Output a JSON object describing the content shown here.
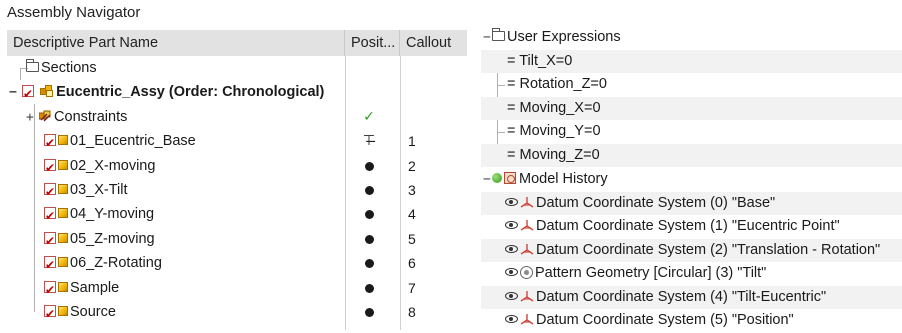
{
  "assembly_navigator": {
    "title": "Assembly Navigator",
    "columns": {
      "name": "Descriptive Part Name",
      "position": "Posit...",
      "callout": "Callout"
    },
    "rows": [
      {
        "label": "Sections",
        "icon": "folder-icon",
        "position": "",
        "callout": ""
      },
      {
        "label": "Eucentric_Assy (Order: Chronological)",
        "icon": "assembly-icon",
        "position": "",
        "callout": ""
      },
      {
        "label": "Constraints",
        "icon": "constraints-icon",
        "position": "✓",
        "callout": ""
      },
      {
        "label": "01_Eucentric_Base",
        "icon": "part-icon",
        "position": "⊤̶",
        "callout": "1"
      },
      {
        "label": "02_X-moving",
        "icon": "part-icon",
        "position": "●",
        "callout": "2"
      },
      {
        "label": "03_X-Tilt",
        "icon": "part-icon",
        "position": "●",
        "callout": "3"
      },
      {
        "label": "04_Y-moving",
        "icon": "part-icon",
        "position": "●",
        "callout": "4"
      },
      {
        "label": "05_Z-moving",
        "icon": "part-icon",
        "position": "●",
        "callout": "5"
      },
      {
        "label": "06_Z-Rotating",
        "icon": "part-icon",
        "position": "●",
        "callout": "6"
      },
      {
        "label": "Sample",
        "icon": "part-icon",
        "position": "●",
        "callout": "7"
      },
      {
        "label": "Source",
        "icon": "part-icon",
        "position": "●",
        "callout": "8"
      }
    ],
    "colors": {
      "checkbox": "#c00000",
      "part": "#f0b400",
      "check": "#2ca01c"
    }
  },
  "part_navigator": {
    "user_expressions": {
      "label": "User Expressions",
      "items": [
        "= Tilt_X=0",
        "= Rotation_Z=0",
        "= Moving_X=0",
        "= Moving_Y=0",
        "= Moving_Z=0"
      ]
    },
    "model_history": {
      "label": "Model History",
      "items": [
        {
          "label": "Datum Coordinate System (0) \"Base\"",
          "icon": "csys-icon"
        },
        {
          "label": "Datum Coordinate System (1) \"Eucentric Point\"",
          "icon": "csys-icon"
        },
        {
          "label": "Datum Coordinate System (2) \"Translation - Rotation\"",
          "icon": "csys-icon"
        },
        {
          "label": "Pattern Geometry [Circular] (3) \"Tilt\"",
          "icon": "pattern-icon"
        },
        {
          "label": "Datum Coordinate System (4) \"Tilt-Eucentric\"",
          "icon": "csys-icon"
        },
        {
          "label": "Datum Coordinate System (5) \"Position\"",
          "icon": "csys-icon"
        }
      ]
    },
    "expander_collapsed": "−",
    "expander_plus": "+"
  }
}
